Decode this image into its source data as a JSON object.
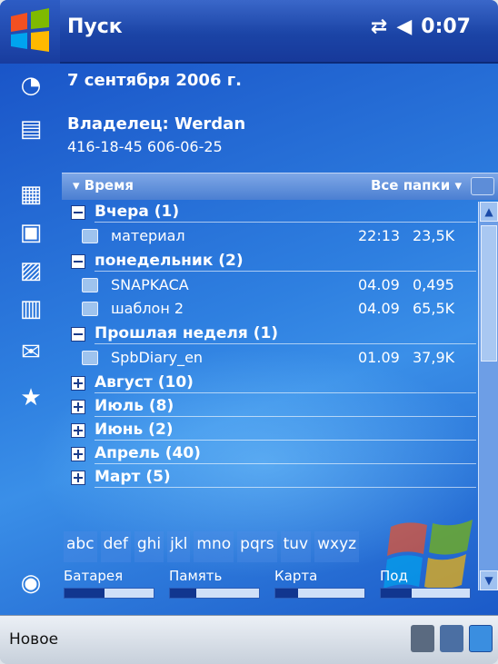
{
  "titlebar": {
    "title": "Пуск",
    "time": "0:07",
    "connectivity_icon": "sync-arrows-icon",
    "volume_icon": "speaker-icon"
  },
  "today": {
    "date": "7 сентября 2006 г.",
    "owner": "Владелец: Werdan",
    "phone": "416-18-45 606-06-25"
  },
  "panel": {
    "sort_label": "Время",
    "folders_label": "Все папки"
  },
  "list": {
    "groups": [
      {
        "label": "Вчера (1)",
        "files": [
          {
            "name": "материал",
            "date": "22:13",
            "size": "23,5K"
          }
        ]
      },
      {
        "label": "понедельник (2)",
        "files": [
          {
            "name": "SNAPKACA",
            "date": "04.09",
            "size": "0,495"
          },
          {
            "name": "шаблон 2",
            "date": "04.09",
            "size": "65,5K"
          }
        ]
      },
      {
        "label": "Прошлая неделя (1)",
        "files": [
          {
            "name": "SpbDiary_en",
            "date": "01.09",
            "size": "37,9K"
          }
        ]
      },
      {
        "label": "Август (10)",
        "files": []
      },
      {
        "label": "Июль (8)",
        "files": []
      },
      {
        "label": "Июнь (2)",
        "files": []
      },
      {
        "label": "Апрель (40)",
        "files": []
      },
      {
        "label": "Март (5)",
        "files": []
      }
    ]
  },
  "alphabet": [
    "abc",
    "def",
    "ghi",
    "jkl",
    "mno",
    "pqrs",
    "tuv",
    "wxyz"
  ],
  "meters": [
    {
      "label": "Батарея",
      "fill": 0.45
    },
    {
      "label": "Память",
      "fill": 0.3
    },
    {
      "label": "Карта",
      "fill": 0.25
    },
    {
      "label": "Под",
      "fill": 0.35
    }
  ],
  "softkeys": {
    "left": "Новое"
  },
  "colors": {
    "accent": "#1b44a6",
    "list_bg": "#2e7fe0",
    "fill": "#11368f"
  }
}
